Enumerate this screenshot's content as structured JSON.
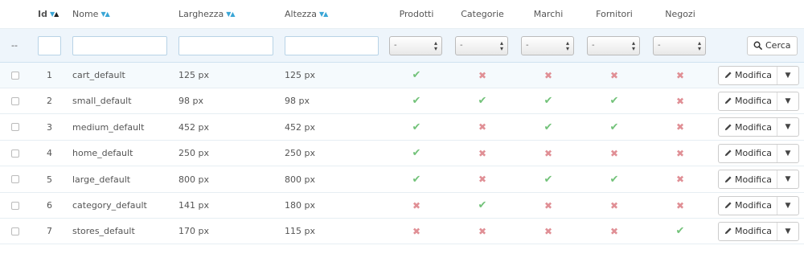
{
  "columns": {
    "id": "Id",
    "name": "Nome",
    "width": "Larghezza",
    "height": "Altezza",
    "products": "Prodotti",
    "categories": "Categorie",
    "brands": "Marchi",
    "suppliers": "Fornitori",
    "stores": "Negozi"
  },
  "filters": {
    "bulk_label": "--",
    "select_value": "-",
    "search_label": "Cerca"
  },
  "actions": {
    "edit_label": "Modifica"
  },
  "colors": {
    "accent": "#3aa6d6",
    "check": "#72c279",
    "cross": "#e08f95"
  },
  "icons": {
    "check": "check-icon",
    "cross": "cross-icon",
    "edit": "pencil-icon",
    "search": "search-icon"
  },
  "rows": [
    {
      "id": "1",
      "name": "cart_default",
      "width": "125 px",
      "height": "125 px",
      "products": true,
      "categories": false,
      "brands": false,
      "suppliers": false,
      "stores": false
    },
    {
      "id": "2",
      "name": "small_default",
      "width": "98 px",
      "height": "98 px",
      "products": true,
      "categories": true,
      "brands": true,
      "suppliers": true,
      "stores": false
    },
    {
      "id": "3",
      "name": "medium_default",
      "width": "452 px",
      "height": "452 px",
      "products": true,
      "categories": false,
      "brands": true,
      "suppliers": true,
      "stores": false
    },
    {
      "id": "4",
      "name": "home_default",
      "width": "250 px",
      "height": "250 px",
      "products": true,
      "categories": false,
      "brands": false,
      "suppliers": false,
      "stores": false
    },
    {
      "id": "5",
      "name": "large_default",
      "width": "800 px",
      "height": "800 px",
      "products": true,
      "categories": false,
      "brands": true,
      "suppliers": true,
      "stores": false
    },
    {
      "id": "6",
      "name": "category_default",
      "width": "141 px",
      "height": "180 px",
      "products": false,
      "categories": true,
      "brands": false,
      "suppliers": false,
      "stores": false
    },
    {
      "id": "7",
      "name": "stores_default",
      "width": "170 px",
      "height": "115 px",
      "products": false,
      "categories": false,
      "brands": false,
      "suppliers": false,
      "stores": true
    }
  ]
}
